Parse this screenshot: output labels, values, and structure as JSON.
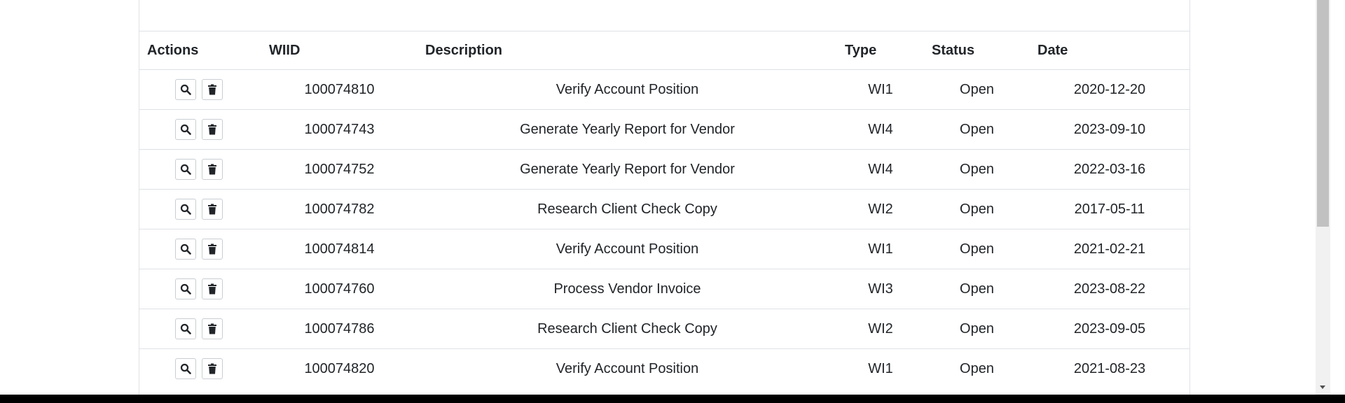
{
  "table": {
    "headers": {
      "actions": "Actions",
      "wiid": "WIID",
      "description": "Description",
      "type": "Type",
      "status": "Status",
      "date": "Date"
    },
    "rows": [
      {
        "wiid": "100074810",
        "description": "Verify Account Position",
        "type": "WI1",
        "status": "Open",
        "date": "2020-12-20"
      },
      {
        "wiid": "100074743",
        "description": "Generate Yearly Report for Vendor",
        "type": "WI4",
        "status": "Open",
        "date": "2023-09-10"
      },
      {
        "wiid": "100074752",
        "description": "Generate Yearly Report for Vendor",
        "type": "WI4",
        "status": "Open",
        "date": "2022-03-16"
      },
      {
        "wiid": "100074782",
        "description": "Research Client Check Copy",
        "type": "WI2",
        "status": "Open",
        "date": "2017-05-11"
      },
      {
        "wiid": "100074814",
        "description": "Verify Account Position",
        "type": "WI1",
        "status": "Open",
        "date": "2021-02-21"
      },
      {
        "wiid": "100074760",
        "description": "Process Vendor Invoice",
        "type": "WI3",
        "status": "Open",
        "date": "2023-08-22"
      },
      {
        "wiid": "100074786",
        "description": "Research Client Check Copy",
        "type": "WI2",
        "status": "Open",
        "date": "2023-09-05"
      },
      {
        "wiid": "100074820",
        "description": "Verify Account Position",
        "type": "WI1",
        "status": "Open",
        "date": "2021-08-23"
      }
    ],
    "row_actions": [
      "search-icon",
      "trash-icon"
    ]
  }
}
